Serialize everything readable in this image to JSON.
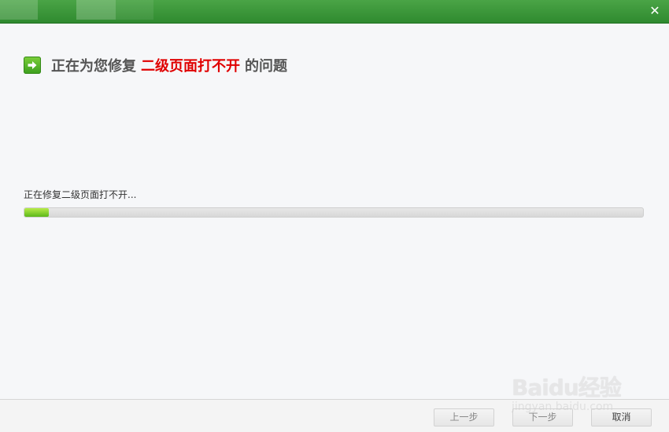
{
  "window": {
    "close_glyph": "✕",
    "accent_color": "#3c963a"
  },
  "heading": {
    "prefix": "正在为您修复",
    "highlight": "二级页面打不开",
    "suffix": "的问题",
    "icon": "arrow-right-icon",
    "highlight_color": "#e00000"
  },
  "progress": {
    "status_text": "正在修复二级页面打不开...",
    "percent": 4
  },
  "buttons": {
    "prev_label": "上一步",
    "next_label": "下一步",
    "cancel_label": "取消"
  },
  "watermark": {
    "logo": "Baidu经验",
    "url": "jingyan.baidu.com"
  }
}
